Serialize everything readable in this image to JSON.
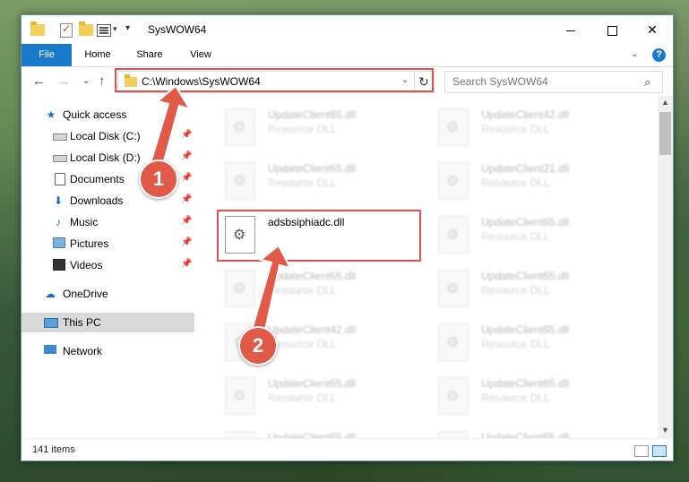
{
  "window": {
    "title": "SysWOW64",
    "controls": {
      "minimize": "",
      "maximize": "",
      "close": "✕"
    }
  },
  "ribbon": {
    "tabs": [
      "File",
      "Home",
      "Share",
      "View"
    ],
    "expand": "⌄",
    "help": "?"
  },
  "nav": {
    "back": "←",
    "forward": "→",
    "recent": "⌄",
    "up": "↑",
    "address": "C:\\Windows\\SysWOW64",
    "address_dropdown": "⌄",
    "refresh": "↻",
    "search_placeholder": "Search SysWOW64",
    "search_icon": "⌕"
  },
  "sidebar": {
    "items": [
      {
        "label": "Quick access",
        "icon": "star-icon",
        "pinned": false
      },
      {
        "label": "Local Disk (C:)",
        "icon": "disk-icon",
        "pinned": true
      },
      {
        "label": "Local Disk (D:)",
        "icon": "disk-icon",
        "pinned": true
      },
      {
        "label": "Documents",
        "icon": "document-icon",
        "pinned": true
      },
      {
        "label": "Downloads",
        "icon": "download-icon",
        "pinned": true
      },
      {
        "label": "Music",
        "icon": "music-icon",
        "pinned": true
      },
      {
        "label": "Pictures",
        "icon": "pictures-icon",
        "pinned": true
      },
      {
        "label": "Videos",
        "icon": "videos-icon",
        "pinned": true
      },
      {
        "label": "OneDrive",
        "icon": "cloud-icon",
        "pinned": false
      },
      {
        "label": "This PC",
        "icon": "computer-icon",
        "pinned": false,
        "selected": true
      },
      {
        "label": "Network",
        "icon": "network-icon",
        "pinned": false
      }
    ],
    "pin_glyph": "📌"
  },
  "files": {
    "left": [
      {
        "name": "UpdateClient65.dll",
        "type": "Resource DLL"
      },
      {
        "name": "UpdateClient65.dll",
        "type": "Resource DLL"
      },
      {
        "name": "adsbsiphiadc.dll",
        "type": "",
        "main": true
      },
      {
        "name": "UpdateClient65.dll",
        "type": "Resource DLL"
      },
      {
        "name": "UpdateClient42.dll",
        "type": "Resource DLL"
      },
      {
        "name": "UpdateClient65.dll",
        "type": "Resource DLL"
      },
      {
        "name": "UpdateClient65.dll",
        "type": "Resource DLL"
      }
    ],
    "right": [
      {
        "name": "UpdateClient42.dll",
        "type": "Resource DLL"
      },
      {
        "name": "UpdateClient21.dll",
        "type": "Resource DLL"
      },
      {
        "name": "UpdateClient65.dll",
        "type": "Resource DLL"
      },
      {
        "name": "UpdateClient65.dll",
        "type": "Resource DLL"
      },
      {
        "name": "UpdateClient65.dll",
        "type": "Resource DLL"
      },
      {
        "name": "UpdateClient65.dll",
        "type": "Resource DLL"
      },
      {
        "name": "UpdateClient65.dll",
        "type": "Resource DLL"
      }
    ]
  },
  "status": {
    "count": "141 items"
  },
  "annotations": {
    "badge1": "1",
    "badge2": "2",
    "highlight_color": "#d9534f",
    "badge_color": "#e05a47"
  }
}
